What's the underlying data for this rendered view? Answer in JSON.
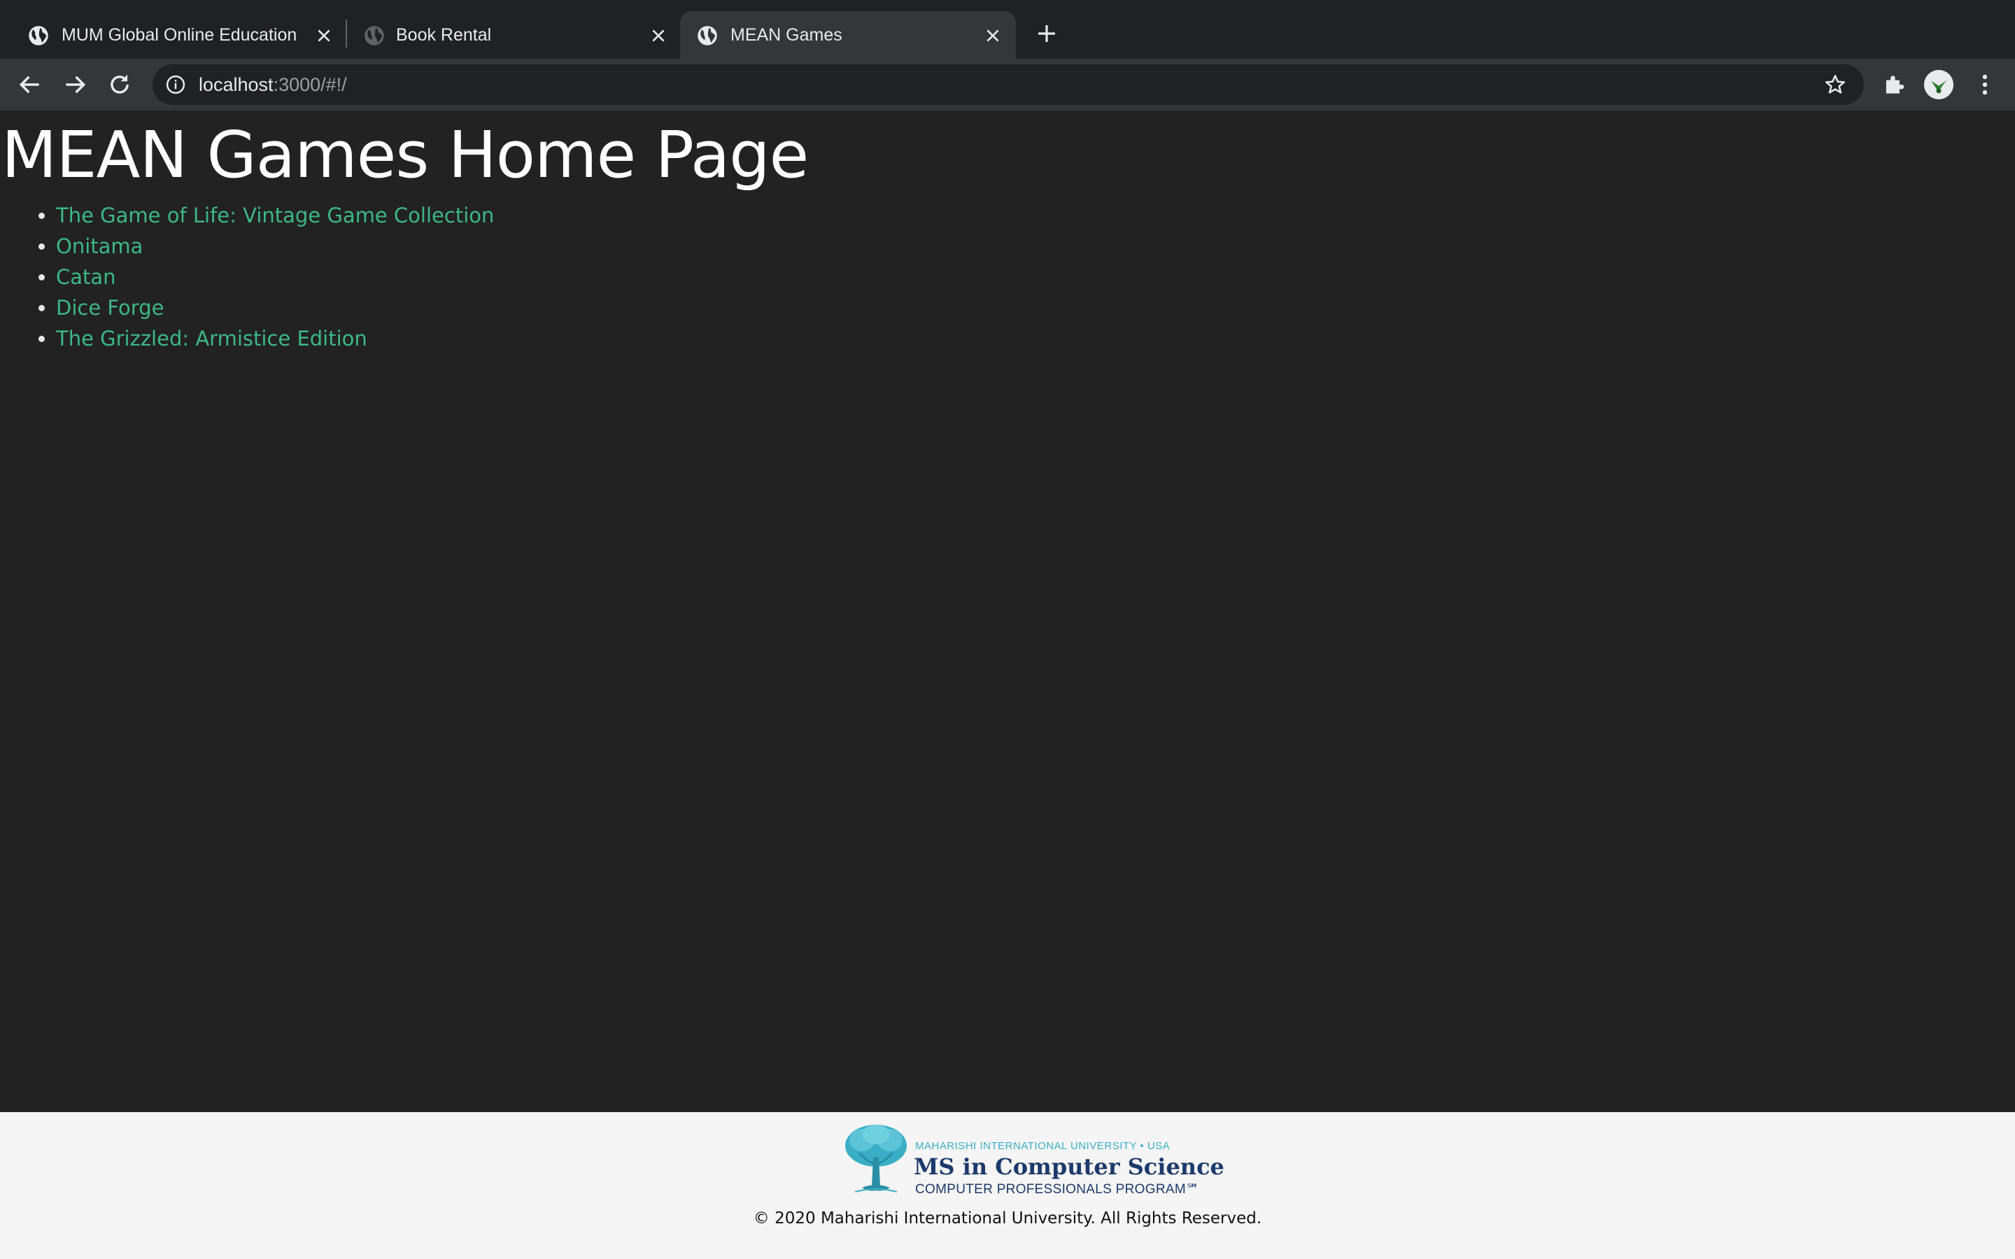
{
  "browser": {
    "tabs": [
      {
        "title": "MUM Global Online Education",
        "icon": "globe-icon",
        "active": false
      },
      {
        "title": "Book Rental",
        "icon": "globe-icon",
        "active": false
      },
      {
        "title": "MEAN Games",
        "icon": "globe-icon",
        "active": true
      }
    ],
    "address": {
      "host": "localhost",
      "rest": ":3000/#!/"
    },
    "toolbar_icons": [
      "back-arrow-icon",
      "forward-arrow-icon",
      "reload-icon",
      "info-icon",
      "star-icon",
      "extensions-puzzle-icon",
      "avatar",
      "more-vert-icon"
    ]
  },
  "page": {
    "title": "MEAN Games Home Page",
    "games": [
      "The Game of Life: Vintage Game Collection",
      "Onitama",
      "Catan",
      "Dice Forge",
      "The Grizzled: Armistice Edition"
    ],
    "link_color": "#3db78a",
    "background": "#222222"
  },
  "footer": {
    "logo": {
      "university": "MAHARISHI INTERNATIONAL UNIVERSITY • USA",
      "program": "MS in Computer Science",
      "subprogram": "COMPUTER PROFESSIONALS PROGRAM℠"
    },
    "copyright": "© 2020 Maharishi International University. All Rights Reserved."
  }
}
